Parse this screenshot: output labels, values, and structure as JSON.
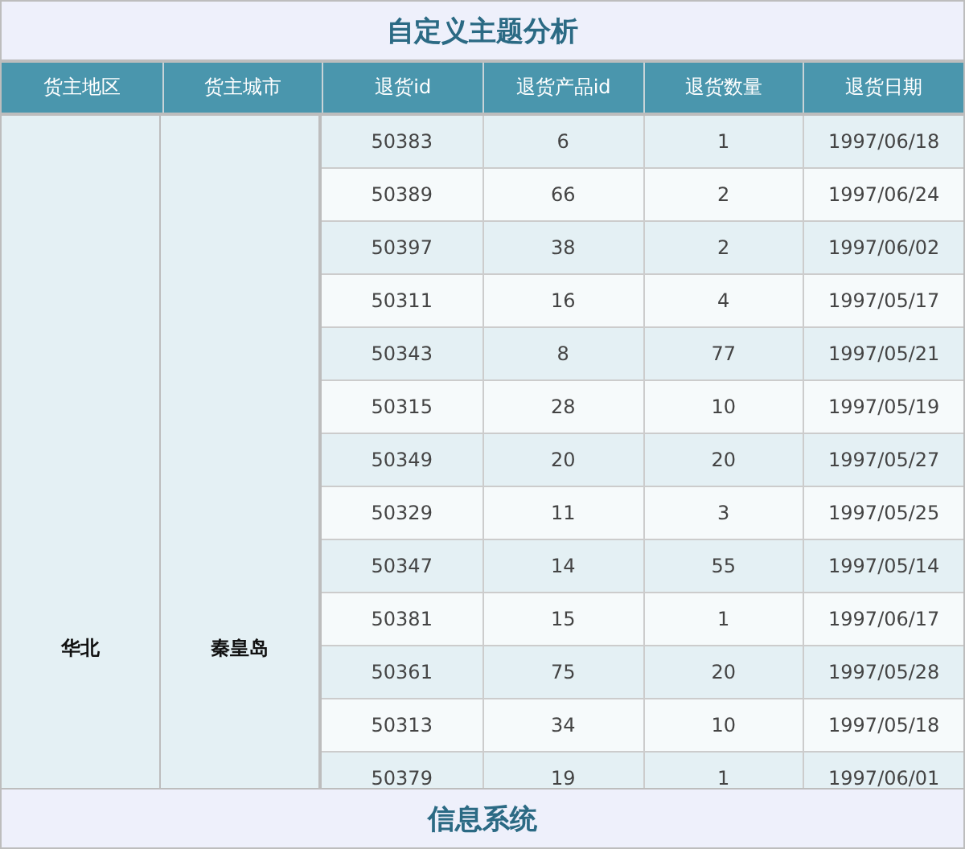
{
  "title": "自定义主题分析",
  "columns": [
    "货主地区",
    "货主城市",
    "退货id",
    "退货产品id",
    "退货数量",
    "退货日期"
  ],
  "group": {
    "region": "华北",
    "city": "秦皇岛"
  },
  "rows": [
    {
      "id": "50383",
      "product": "6",
      "qty": "1",
      "date": "1997/06/18"
    },
    {
      "id": "50389",
      "product": "66",
      "qty": "2",
      "date": "1997/06/24"
    },
    {
      "id": "50397",
      "product": "38",
      "qty": "2",
      "date": "1997/06/02"
    },
    {
      "id": "50311",
      "product": "16",
      "qty": "4",
      "date": "1997/05/17"
    },
    {
      "id": "50343",
      "product": "8",
      "qty": "77",
      "date": "1997/05/21"
    },
    {
      "id": "50315",
      "product": "28",
      "qty": "10",
      "date": "1997/05/19"
    },
    {
      "id": "50349",
      "product": "20",
      "qty": "20",
      "date": "1997/05/27"
    },
    {
      "id": "50329",
      "product": "11",
      "qty": "3",
      "date": "1997/05/25"
    },
    {
      "id": "50347",
      "product": "14",
      "qty": "55",
      "date": "1997/05/14"
    },
    {
      "id": "50381",
      "product": "15",
      "qty": "1",
      "date": "1997/06/17"
    },
    {
      "id": "50361",
      "product": "75",
      "qty": "20",
      "date": "1997/05/28"
    },
    {
      "id": "50313",
      "product": "34",
      "qty": "10",
      "date": "1997/05/18"
    },
    {
      "id": "50379",
      "product": "19",
      "qty": "1",
      "date": "1997/06/01"
    }
  ],
  "footer": "信息系统"
}
